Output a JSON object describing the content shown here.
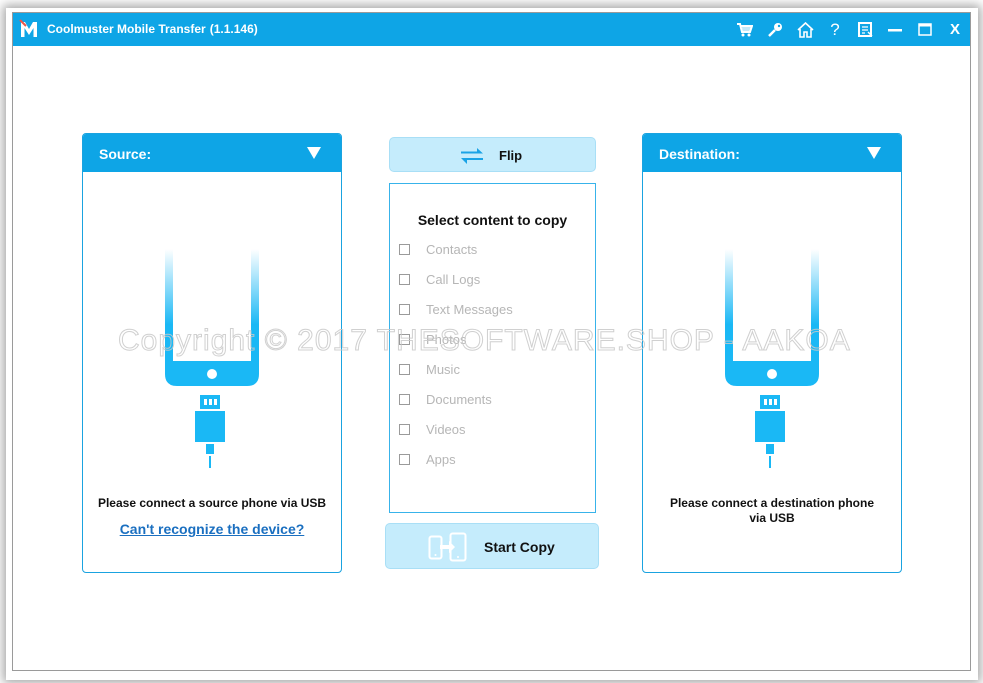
{
  "window": {
    "app_name": "Coolmuster Mobile Transfer",
    "version": "(1.1.146)",
    "logo_letter": "M",
    "titlebar_icons": [
      "cart-icon",
      "key-icon",
      "home-icon",
      "help-icon",
      "feedback-icon",
      "minimize-icon",
      "maximize-icon",
      "close-icon"
    ],
    "close_label": "X",
    "help_label": "?"
  },
  "colors": {
    "accent": "#0ea5e6",
    "button_bg": "#c5ecfc",
    "phone_blue": "#1ab8f5",
    "link": "#1a6fc0",
    "disabled_text": "#b6b6b6"
  },
  "source": {
    "label": "Source:",
    "message": "Please connect a source phone via USB",
    "link": "Can't recognize the device?"
  },
  "destination": {
    "label": "Destination:",
    "message": "Please connect a destination phone via USB"
  },
  "flip": {
    "label": "Flip"
  },
  "content": {
    "heading": "Select content to copy",
    "items": [
      {
        "label": "Contacts",
        "checked": false
      },
      {
        "label": "Call Logs",
        "checked": false
      },
      {
        "label": "Text Messages",
        "checked": false
      },
      {
        "label": "Photos",
        "checked": false
      },
      {
        "label": "Music",
        "checked": false
      },
      {
        "label": "Documents",
        "checked": false
      },
      {
        "label": "Videos",
        "checked": false
      },
      {
        "label": "Apps",
        "checked": false
      }
    ]
  },
  "start_copy": {
    "label": "Start Copy"
  },
  "watermark": "Copyright © 2017 THESOFTWARE.SHOP - AAKOA"
}
